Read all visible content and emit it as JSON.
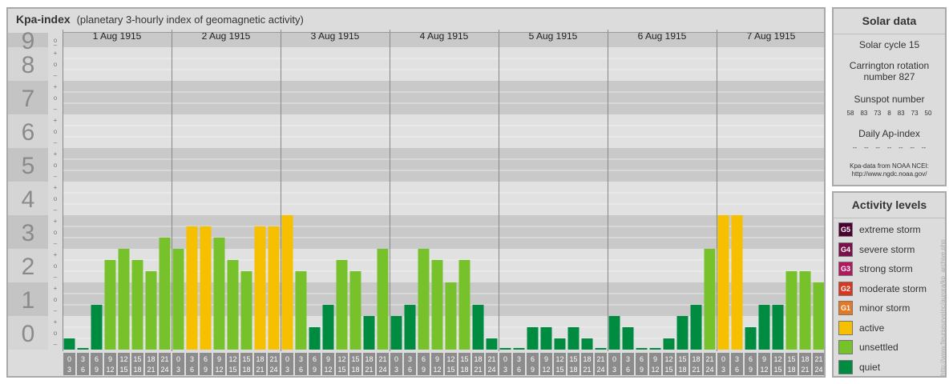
{
  "header": {
    "title": "Kpa-index",
    "subtitle": "(planetary 3-hourly index of geomagnetic activity)"
  },
  "colors": {
    "quiet": "#008c40",
    "unsettled": "#77c22b",
    "active": "#f6c000",
    "minor": "#e87722",
    "moderate": "#d9361f",
    "strong": "#b2185e",
    "severe": "#7a0f4a",
    "extreme": "#4a0030"
  },
  "chart_data": {
    "type": "bar",
    "title": "Kpa-index",
    "ylim": [
      0,
      9
    ],
    "y_ticks": [
      "0",
      "1",
      "2",
      "3",
      "4",
      "5",
      "6",
      "7",
      "8",
      "9"
    ],
    "y_subticks": [
      "+",
      "o",
      "–"
    ],
    "days": [
      "1 Aug 1915",
      "2 Aug 1915",
      "3 Aug 1915",
      "4 Aug 1915",
      "5 Aug 1915",
      "6 Aug 1915",
      "7 Aug 1915"
    ],
    "hour_labels": [
      [
        "0",
        "3"
      ],
      [
        "3",
        "6"
      ],
      [
        "6",
        "9"
      ],
      [
        "9",
        "12"
      ],
      [
        "12",
        "15"
      ],
      [
        "15",
        "18"
      ],
      [
        "18",
        "21"
      ],
      [
        "21",
        "24"
      ]
    ],
    "values": [
      [
        0.333,
        0,
        1.333,
        2.667,
        3,
        2.667,
        2.333,
        3.333
      ],
      [
        3,
        3.667,
        3.667,
        3.333,
        2.667,
        2.333,
        3.667,
        3.667
      ],
      [
        4,
        2.333,
        0.667,
        1.333,
        2.667,
        2.333,
        1,
        3
      ],
      [
        1,
        1.333,
        3,
        2.667,
        2,
        2.667,
        1.333,
        0.333
      ],
      [
        0,
        0,
        0.667,
        0.667,
        0.333,
        0.667,
        0.333,
        0
      ],
      [
        1,
        0.667,
        0,
        0,
        0.333,
        1,
        1.333,
        3
      ],
      [
        4,
        4,
        0.667,
        1.333,
        1.333,
        2.333,
        2.333,
        2
      ]
    ]
  },
  "solar": {
    "title": "Solar data",
    "cycle": "Solar cycle 15",
    "carrington_1": "Carrington rotation",
    "carrington_2": "number 827",
    "sunspot_title": "Sunspot number",
    "sunspot_values": [
      "58",
      "83",
      "73",
      "8",
      "83",
      "73",
      "50"
    ],
    "ap_title": "Daily Ap-index",
    "ap_values": [
      "--",
      "--",
      "--",
      "--",
      "--",
      "--",
      "--"
    ],
    "footnote_1": "Kpa-data from NOAA NCEI:",
    "footnote_2": "http://www.ngdc.noaa.gov/"
  },
  "activity": {
    "title": "Activity levels",
    "items": [
      {
        "code": "G5",
        "label": "extreme storm",
        "color": "#4a0030"
      },
      {
        "code": "G4",
        "label": "severe storm",
        "color": "#7a0f4a"
      },
      {
        "code": "G3",
        "label": "strong storm",
        "color": "#b2185e"
      },
      {
        "code": "G2",
        "label": "moderate storm",
        "color": "#d9361f"
      },
      {
        "code": "G1",
        "label": "minor storm",
        "color": "#e87722"
      },
      {
        "code": "",
        "label": "active",
        "color": "#f6c000"
      },
      {
        "code": "",
        "label": "unsettled",
        "color": "#77c22b"
      },
      {
        "code": "",
        "label": "quiet",
        "color": "#008c40"
      }
    ]
  },
  "watermark": "http://www.fleurseurveinc/aurora/kp_archive.php"
}
